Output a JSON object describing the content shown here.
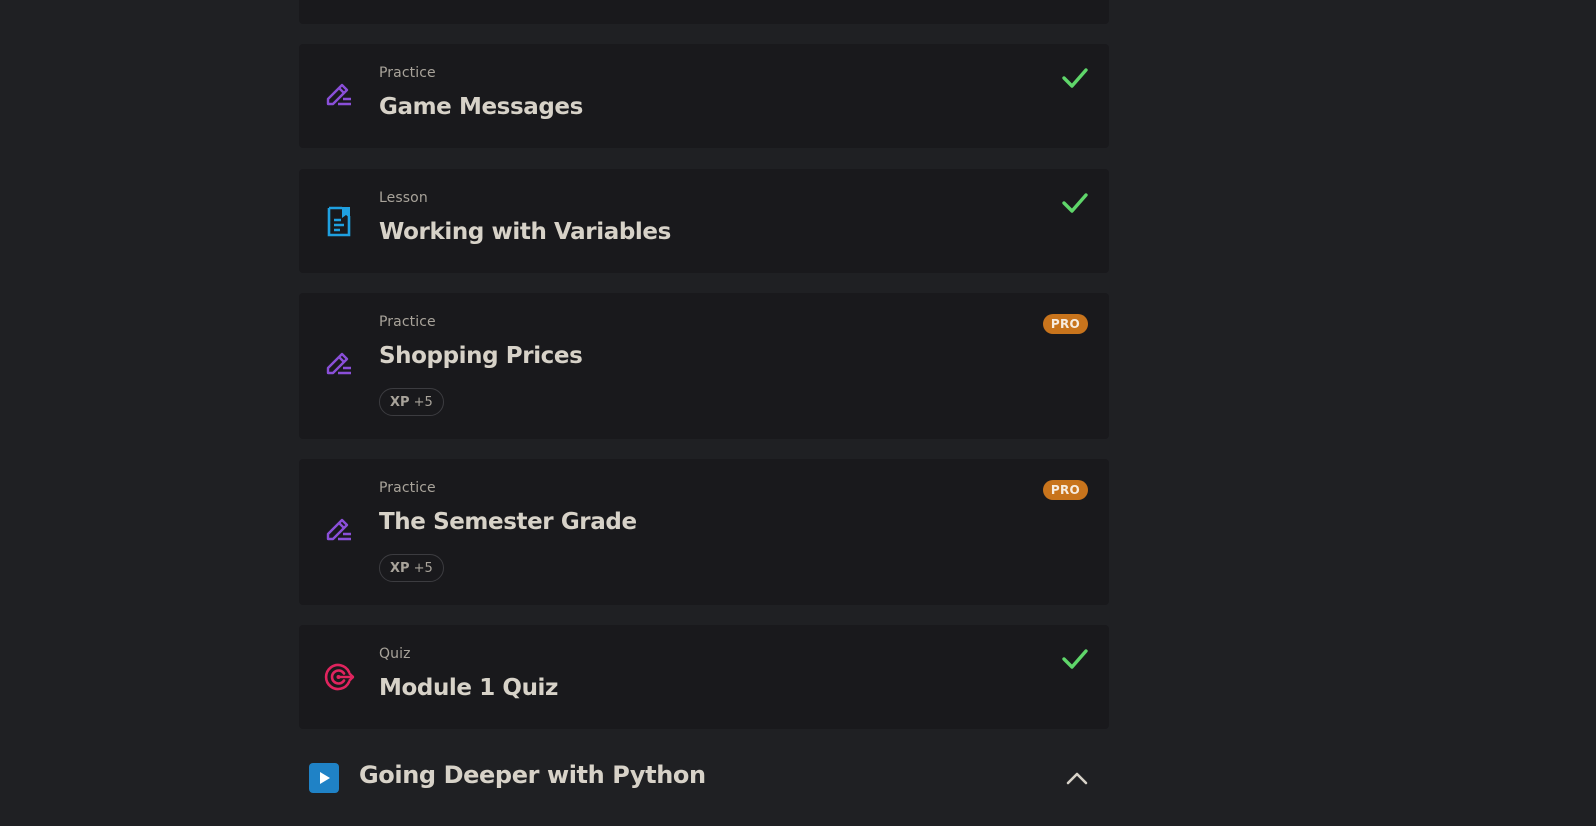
{
  "items": [
    {
      "kind": "Practice",
      "title": "Game Messages",
      "icon": "practice-pencil-icon",
      "status": "completed"
    },
    {
      "kind": "Lesson",
      "title": "Working with Variables",
      "icon": "lesson-document-icon",
      "status": "completed"
    },
    {
      "kind": "Practice",
      "title": "Shopping Prices",
      "icon": "practice-pencil-icon",
      "status": "pro",
      "badge": "PRO",
      "xp_label": "XP",
      "xp_value": "+5"
    },
    {
      "kind": "Practice",
      "title": "The Semester Grade",
      "icon": "practice-pencil-icon",
      "status": "pro",
      "badge": "PRO",
      "xp_label": "XP",
      "xp_value": "+5"
    },
    {
      "kind": "Quiz",
      "title": "Module 1 Quiz",
      "icon": "quiz-target-icon",
      "status": "completed"
    }
  ],
  "next_module": {
    "title": "Going Deeper with Python",
    "icon": "play-icon",
    "toggle_icon": "chevron-up-icon"
  },
  "colors": {
    "page_bg": "#1f2023",
    "card_bg": "#19191c",
    "practice_icon": "#8a4fd8",
    "lesson_icon": "#1fa0e0",
    "quiz_icon": "#e0245e",
    "check": "#5fd66a",
    "pro_badge": "#c8741c",
    "play_button": "#1f82c6"
  }
}
